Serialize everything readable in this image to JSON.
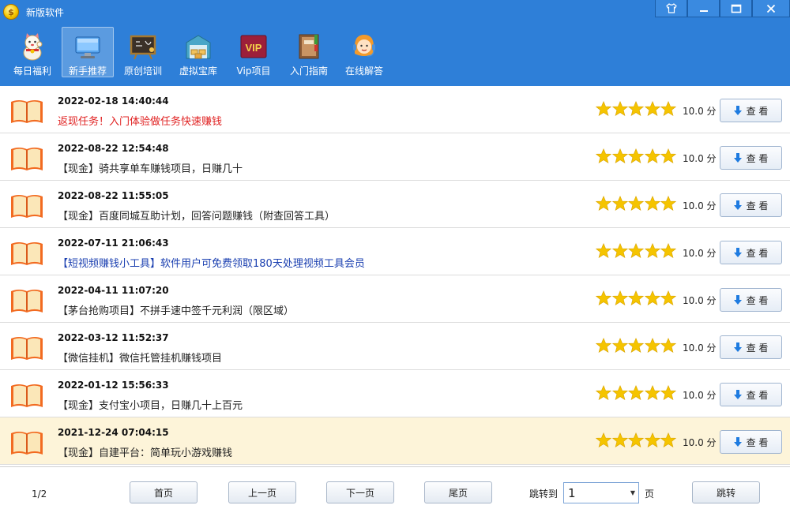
{
  "window": {
    "title": "新版软件",
    "controls": [
      "shirt-icon",
      "minimize-icon",
      "maximize-icon",
      "close-icon"
    ]
  },
  "toolbar": {
    "items": [
      {
        "label": "每日福利",
        "icon": "lucky-cat-icon"
      },
      {
        "label": "新手推荐",
        "icon": "monitor-icon",
        "active": true
      },
      {
        "label": "原创培训",
        "icon": "chalkboard-icon"
      },
      {
        "label": "虚拟宝库",
        "icon": "warehouse-icon"
      },
      {
        "label": "Vip项目",
        "icon": "vip-icon",
        "badge": "VIP"
      },
      {
        "label": "入门指南",
        "icon": "guide-book-icon"
      },
      {
        "label": "在线解答",
        "icon": "support-agent-icon"
      }
    ]
  },
  "list": {
    "rating_label": "10.0 分",
    "view_label": "查 看",
    "items": [
      {
        "timestamp": "2022-02-18 14:40:44",
        "title": "返现任务！入门体验做任务快速赚钱",
        "title_color": "#e02020",
        "stars": 5
      },
      {
        "timestamp": "2022-08-22 12:54:48",
        "title": "【现金】骑共享单车赚钱项目，日赚几十",
        "title_color": "#222222",
        "stars": 5
      },
      {
        "timestamp": "2022-08-22 11:55:05",
        "title": "【现金】百度同城互助计划，回答问题赚钱（附查回答工具）",
        "title_color": "#222222",
        "stars": 5
      },
      {
        "timestamp": "2022-07-11 21:06:43",
        "title": "【短视频赚钱小工具】软件用户可免费领取180天处理视频工具会员",
        "title_color": "#1a3fb0",
        "stars": 5
      },
      {
        "timestamp": "2022-04-11 11:07:20",
        "title": "【茅台抢购项目】不拼手速中签千元利润（限区域）",
        "title_color": "#222222",
        "stars": 5
      },
      {
        "timestamp": "2022-03-12 11:52:37",
        "title": "【微信挂机】微信托管挂机赚钱项目",
        "title_color": "#222222",
        "stars": 5
      },
      {
        "timestamp": "2022-01-12 15:56:33",
        "title": "【现金】支付宝小项目，日赚几十上百元",
        "title_color": "#222222",
        "stars": 5
      },
      {
        "timestamp": "2021-12-24 07:04:15",
        "title": "【现金】自建平台：简单玩小游戏赚钱",
        "title_color": "#222222",
        "stars": 5,
        "selected": true
      }
    ]
  },
  "footer": {
    "page_info": "1/2",
    "first_label": "首页",
    "prev_label": "上一页",
    "next_label": "下一页",
    "last_label": "尾页",
    "jump_label": "跳转到",
    "page_value": "1",
    "page_unit": "页",
    "jump_button": "跳转"
  },
  "colors": {
    "accent": "#2e7fd8",
    "star": "#f5c400",
    "selected_row": "#fdf4d9"
  }
}
